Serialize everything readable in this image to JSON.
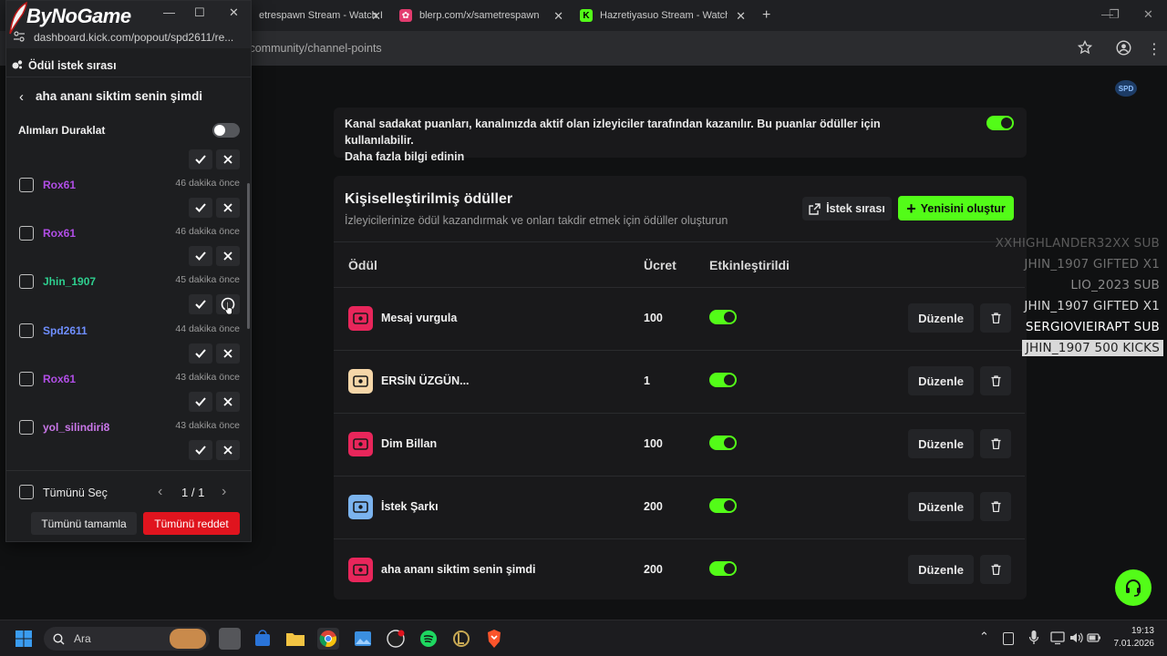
{
  "browser": {
    "tabs": [
      {
        "label": "etrespawn Stream - Watch I"
      },
      {
        "label": "blerp.com/x/sametrespawn"
      },
      {
        "label": "Hazretiyasuo Stream - Watch Li"
      }
    ],
    "url": "/community/channel-points",
    "new_tab": "+"
  },
  "watermark": "ByNoGame",
  "popout": {
    "url": "dashboard.kick.com/popout/spd2611/re...",
    "title": "Ödül istek sırası",
    "reward_name": "aha ananı siktim senin şimdi",
    "pause_label": "Alımları Duraklat",
    "requests": [
      {
        "user": "Rox61",
        "time": "46 dakika önce",
        "color": "#b14ee6"
      },
      {
        "user": "Rox61",
        "time": "46 dakika önce",
        "color": "#b14ee6"
      },
      {
        "user": "Jhin_1907",
        "time": "45 dakika önce",
        "color": "#2ecf8f"
      },
      {
        "user": "Spd2611",
        "time": "44 dakika önce",
        "color": "#6f8fff"
      },
      {
        "user": "Rox61",
        "time": "43 dakika önce",
        "color": "#b14ee6"
      },
      {
        "user": "yol_silindiri8",
        "time": "43 dakika önce",
        "color": "#c977e8"
      }
    ],
    "select_all": "Tümünü Seç",
    "pagination": "1 / 1",
    "complete_all": "Tümünü tamamla",
    "reject_all": "Tümünü reddet"
  },
  "info_card": {
    "text": "Kanal sadakat puanları, kanalınızda aktif olan izleyiciler tarafından kazanılır. Bu puanlar ödüller için kullanılabilir.",
    "link": "Daha fazla bilgi edinin"
  },
  "rewards_card": {
    "title": "Kişiselleştirilmiş ödüller",
    "subtitle": "İzleyicilerinize ödül kazandırmak ve onları takdir etmek için ödüller oluşturun",
    "queue_button": "İstek sırası",
    "create_button": "Yenisini oluştur",
    "columns": {
      "reward": "Ödül",
      "cost": "Ücret",
      "enabled": "Etkinleştirildi"
    },
    "edit_label": "Düzenle",
    "rows": [
      {
        "name": "Mesaj vurgula",
        "cost": "100",
        "icon_color": "#e8265b",
        "enabled": true
      },
      {
        "name": "ERSİN ÜZGÜN...",
        "cost": "1",
        "icon_color": "#f5d6a8",
        "enabled": true
      },
      {
        "name": "Dim Billan",
        "cost": "100",
        "icon_color": "#e8265b",
        "enabled": true
      },
      {
        "name": "İstek Şarkı",
        "cost": "200",
        "icon_color": "#7bb3ee",
        "enabled": true
      },
      {
        "name": "aha ananı siktim senin şimdi",
        "cost": "200",
        "icon_color": "#e8265b",
        "enabled": true
      }
    ]
  },
  "stream_overlay": [
    "XXHIGHLANDER32XX  SUB",
    "JHIN_1907  GIFTED X1",
    "LIO_2023  SUB",
    "JHIN_1907  GIFTED X1",
    "SERGIOVIEIRAPT  SUB",
    "JHIN_1907  500 KICKS"
  ],
  "taskbar": {
    "search_placeholder": "Ara",
    "time": "19:13",
    "date": "7.01.2026"
  },
  "colors": {
    "kick_green": "#53fc18",
    "reject_red": "#e0141e"
  }
}
